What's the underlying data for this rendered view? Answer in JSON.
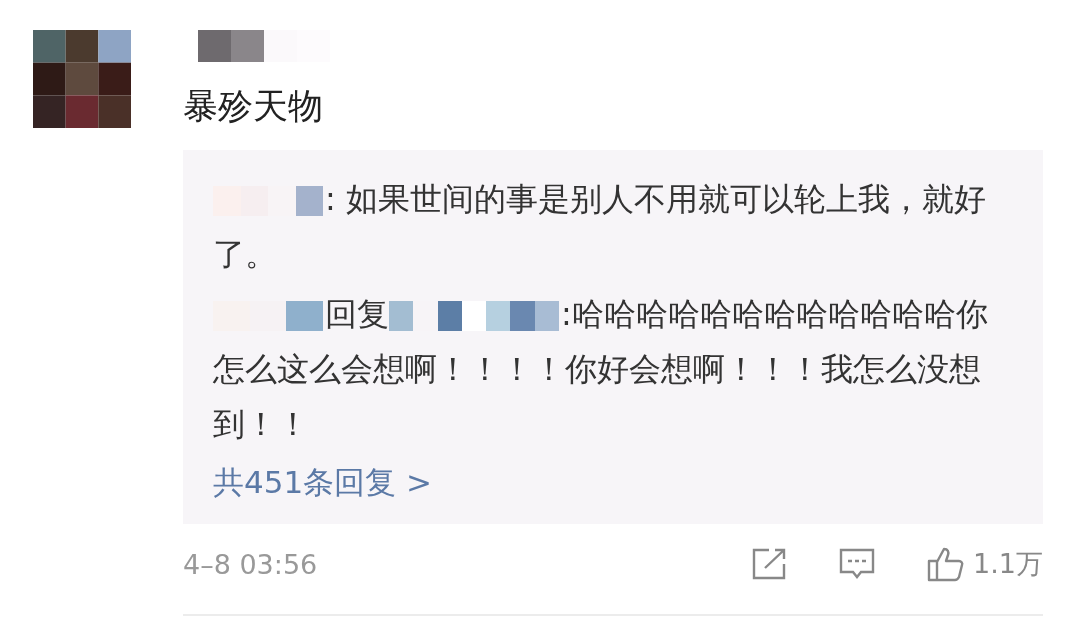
{
  "comment": {
    "text": "暴殄天物"
  },
  "replies": [
    {
      "parts": [
        {
          "kind": "redacted"
        },
        {
          "kind": "text",
          "text": ": 如果世间的事是别人不用就可以轮上我，就好了。"
        }
      ]
    },
    {
      "parts": [
        {
          "kind": "redacted"
        },
        {
          "kind": "text",
          "text": "回复"
        },
        {
          "kind": "redacted"
        },
        {
          "kind": "text",
          "text": ":哈哈哈哈哈哈哈哈哈哈哈哈你怎么这么会想啊！！！！你好会想啊！！！我怎么没想到！！"
        }
      ]
    }
  ],
  "more_link": "共451条回复 >",
  "footer": {
    "time": "4–8 03:56",
    "likes": "1.1万"
  }
}
